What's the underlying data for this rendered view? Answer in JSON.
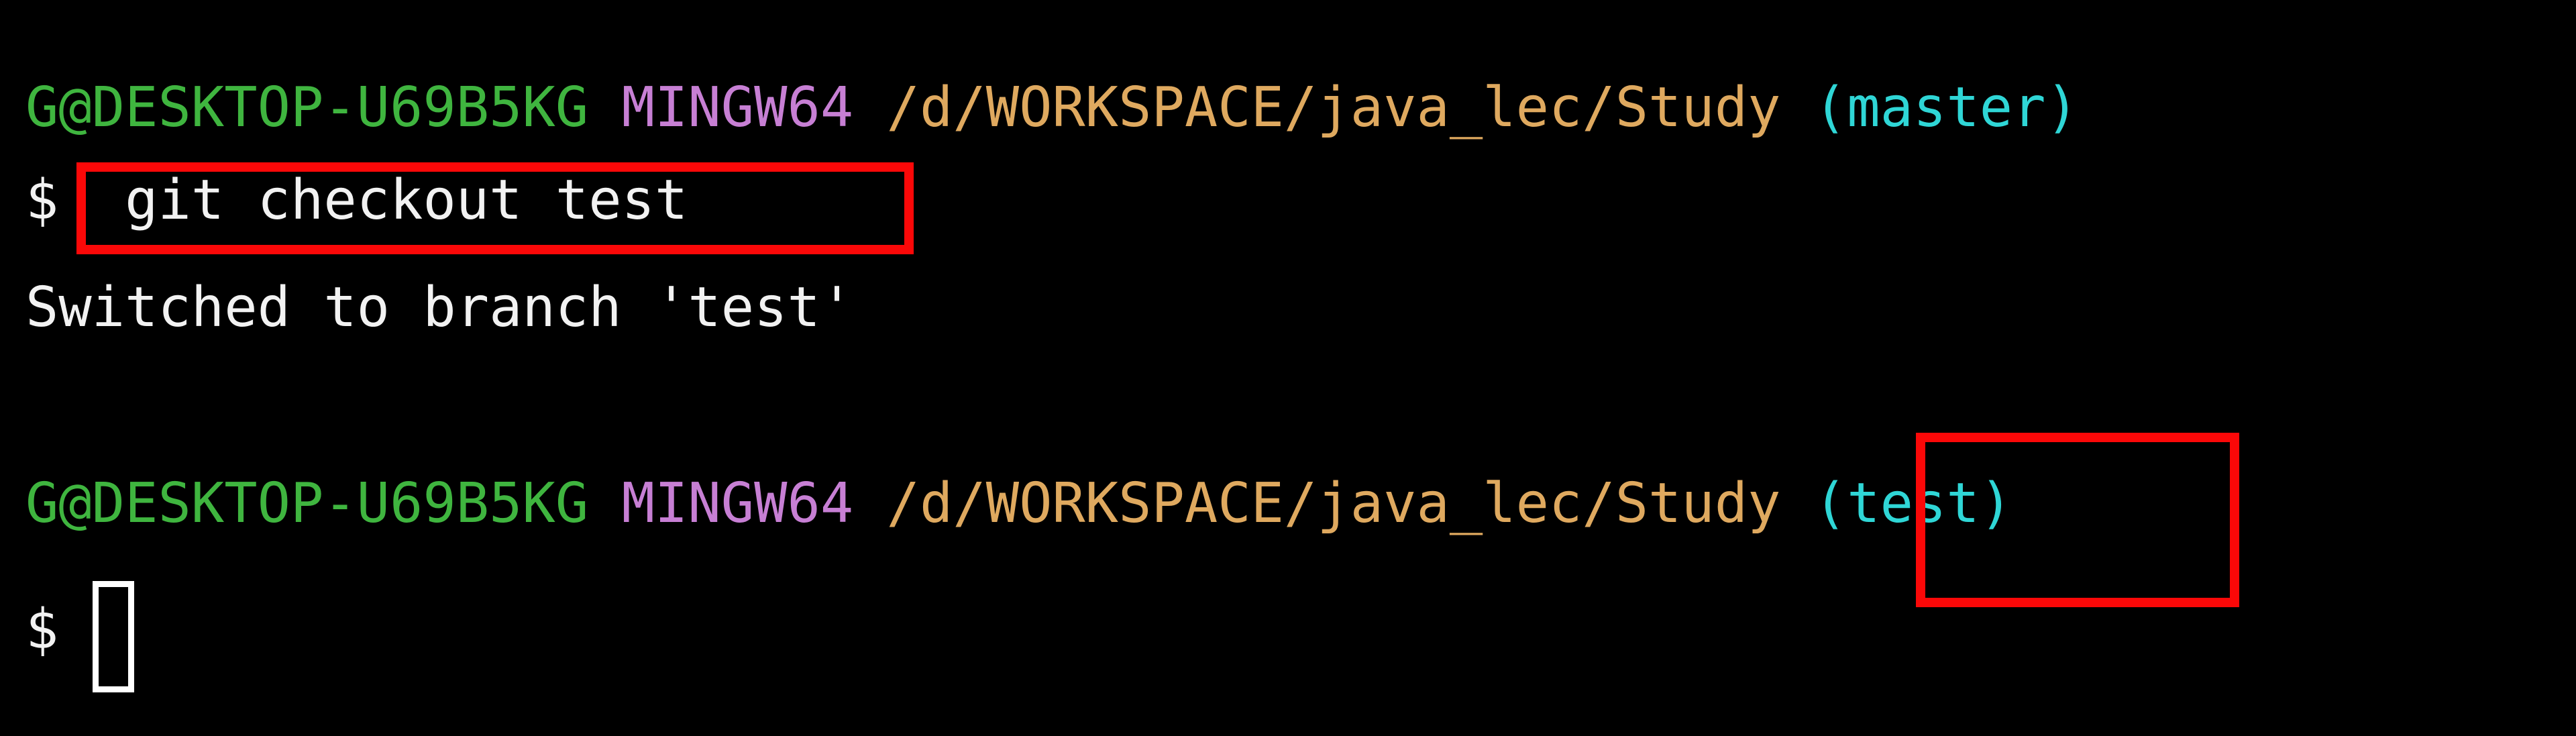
{
  "terminal": {
    "background_color": "#000000",
    "default_text_color": "#f2f2f2",
    "colors": {
      "user_host": "#3fb53f",
      "shell_tag": "#c77fd4",
      "path": "#dfa95f",
      "git_branch": "#2fd6d6",
      "annotation_red": "#fb0808",
      "cursor": "#ffffff"
    },
    "prompt_line_1": {
      "user_host": "G@DESKTOP-U69B5KG",
      "space_1": " ",
      "shell_tag": "MINGW64",
      "space_2": " ",
      "path": "/d/WORKSPACE/java_lec/Study",
      "space_3": " ",
      "git_branch": "(master)"
    },
    "command_line": {
      "prompt_symbol": "$",
      "command": "git checkout test",
      "highlighted": true
    },
    "output_line": {
      "text": "Switched to branch 'test'"
    },
    "prompt_line_2": {
      "user_host": "G@DESKTOP-U69B5KG",
      "space_1": " ",
      "shell_tag": "MINGW64",
      "space_2": " ",
      "path": "/d/WORKSPACE/java_lec/Study",
      "space_3": " ",
      "git_branch": "(test)",
      "branch_highlighted": true
    },
    "last_prompt": {
      "prompt_symbol": "$",
      "cursor_visible": true,
      "cursor_style": "hollow-block"
    }
  }
}
